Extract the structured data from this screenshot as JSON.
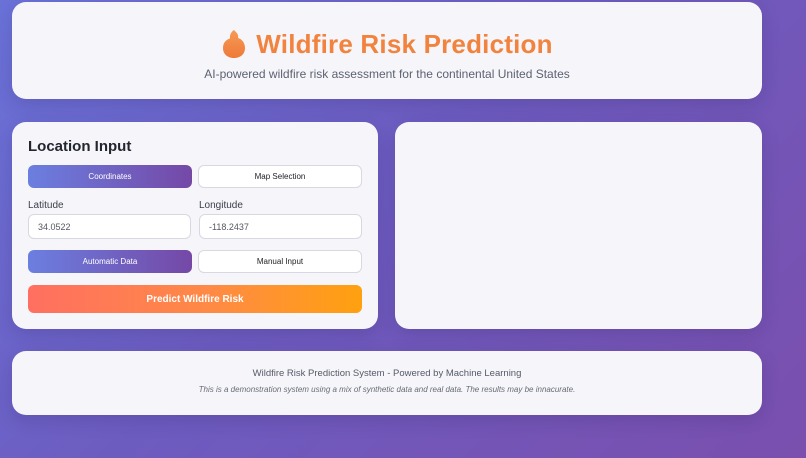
{
  "header": {
    "title": "Wildfire Risk Prediction",
    "subtitle": "AI-powered wildfire risk assessment for the continental United States",
    "icon": "flame-icon"
  },
  "input_panel": {
    "heading": "Location Input",
    "mode_tabs": {
      "coordinates_label": "Coordinates",
      "map_label": "Map Selection",
      "selected": "Coordinates"
    },
    "latitude": {
      "label": "Latitude",
      "value": "34.0522"
    },
    "longitude": {
      "label": "Longitude",
      "value": "-118.2437"
    },
    "data_tabs": {
      "automatic_label": "Automatic Data",
      "manual_label": "Manual Input",
      "selected": "Automatic Data"
    },
    "predict_label": "Predict Wildfire Risk"
  },
  "footer": {
    "main": "Wildfire Risk Prediction System - Powered by Machine Learning",
    "note": "This is a demonstration system using a mix of synthetic data and real data. The results may be innacurate."
  },
  "colors": {
    "accent_orange": "#f2833f",
    "tab_active_start": "#6b7fe0",
    "tab_active_end": "#7548a6",
    "predict_start": "#ff6f61",
    "predict_end": "#ffa10f"
  }
}
